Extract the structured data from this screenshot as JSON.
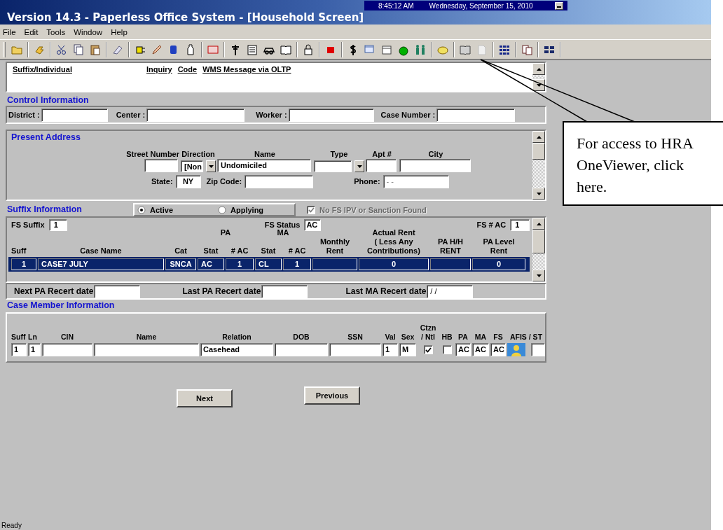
{
  "window": {
    "title": "Version 14.3 - Paperless Office System - [Household Screen]"
  },
  "clock": {
    "time": "8:45:12 AM",
    "date": "Wednesday, September 15, 2010"
  },
  "menu": [
    "File",
    "Edit",
    "Tools",
    "Window",
    "Help"
  ],
  "header_links": [
    "Suffix/Individual",
    "Inquiry",
    "Code",
    "WMS Message via OLTP"
  ],
  "control_information": {
    "title": "Control Information",
    "fields": [
      {
        "label": "District :"
      },
      {
        "label": "Center :"
      },
      {
        "label": "Worker :"
      },
      {
        "label": "Case Number :"
      }
    ]
  },
  "present_address": {
    "title": "Present Address",
    "columns": [
      "Street Number",
      "Direction",
      "Name",
      "Type",
      "Apt #",
      "City"
    ],
    "direction": "[Non",
    "name": "Undomiciled",
    "state_label": "State:",
    "state": "NY",
    "zip_label": "Zip Code:",
    "phone_label": "Phone:",
    "phone": "- -"
  },
  "suffix_information": {
    "title": "Suffix Information",
    "radios": [
      {
        "label": "Active",
        "selected": true
      },
      {
        "label": "Applying",
        "selected": false
      }
    ],
    "checkbox": {
      "label": "No FS IPV or Sanction Found",
      "checked": true,
      "disabled": true
    },
    "fs_suffix_label": "FS Suffix",
    "fs_suffix": "1",
    "fs_status_label": "FS Status",
    "fs_status": "AC",
    "fs_ac_label": "FS # AC",
    "fs_ac": "1"
  },
  "suffix_table": {
    "columns": [
      {
        "label": "Suff"
      },
      {
        "label": "Case Name"
      },
      {
        "label": "Cat"
      },
      {
        "label": "Stat",
        "group": "PA"
      },
      {
        "label": "# AC"
      },
      {
        "label": "Stat",
        "group": "MA"
      },
      {
        "label": "# AC"
      },
      {
        "label": "Monthly\nRent"
      },
      {
        "label": "Actual Rent\n( Less  Any\nContributions)"
      },
      {
        "label": "PA H/H\nRENT"
      },
      {
        "label": "PA Level\nRent"
      }
    ],
    "rows": [
      {
        "selected": true,
        "cells": [
          "1",
          "CASE7 JULY",
          "SNCA",
          "AC",
          "1",
          "CL",
          "1",
          null,
          "0",
          null,
          "0"
        ]
      }
    ]
  },
  "recert_dates": [
    {
      "label": "Next PA Recert date"
    },
    {
      "label": "Last PA Recert date"
    },
    {
      "label": "Last MA Recert date",
      "value": "/ /"
    }
  ],
  "case_members": {
    "title": "Case Member Information",
    "columns": [
      "Suff",
      "Ln",
      "CIN",
      "Name",
      "Relation",
      "DOB",
      "SSN",
      "Val",
      "Sex",
      "Ctzn\n/ Ntl",
      "HB",
      "PA",
      "MA",
      "FS",
      "AFIS / ST"
    ],
    "rows": [
      {
        "cells": [
          {
            "kind": "text",
            "value": "1"
          },
          {
            "kind": "text",
            "value": "1"
          },
          {
            "kind": "text"
          },
          {
            "kind": "text"
          },
          {
            "kind": "text",
            "value": "Casehead"
          },
          {
            "kind": "text"
          },
          {
            "kind": "text"
          },
          {
            "kind": "text",
            "value": "1"
          },
          {
            "kind": "text",
            "value": "M"
          },
          {
            "kind": "check",
            "checked": true
          },
          {
            "kind": "check",
            "checked": false
          },
          {
            "kind": "text",
            "value": "AC"
          },
          {
            "kind": "text",
            "value": "AC"
          },
          {
            "kind": "text",
            "value": "AC"
          },
          {
            "kind": "icon"
          },
          {
            "kind": "text"
          }
        ]
      }
    ]
  },
  "buttons": [
    "Next",
    "Previous"
  ],
  "status_bar": "Ready",
  "callout": "For access to HRA OneViewer, click here."
}
